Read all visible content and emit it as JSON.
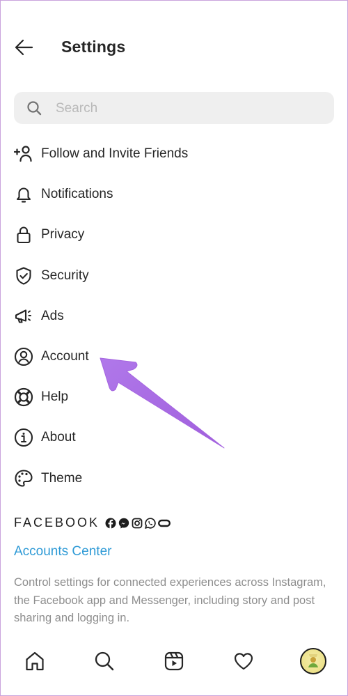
{
  "header": {
    "title": "Settings",
    "back_icon": "arrow-left-icon"
  },
  "search": {
    "placeholder": "Search",
    "value": "",
    "icon": "search-icon"
  },
  "menu": {
    "items": [
      {
        "label": "Follow and Invite Friends",
        "icon": "add-person-icon"
      },
      {
        "label": "Notifications",
        "icon": "bell-icon"
      },
      {
        "label": "Privacy",
        "icon": "lock-icon"
      },
      {
        "label": "Security",
        "icon": "shield-check-icon"
      },
      {
        "label": "Ads",
        "icon": "megaphone-icon"
      },
      {
        "label": "Account",
        "icon": "user-circle-icon"
      },
      {
        "label": "Help",
        "icon": "lifebuoy-icon"
      },
      {
        "label": "About",
        "icon": "info-icon"
      },
      {
        "label": "Theme",
        "icon": "palette-icon"
      }
    ]
  },
  "facebook": {
    "wordmark": "FACEBOOK",
    "app_icons": [
      "facebook-icon",
      "messenger-icon",
      "instagram-icon",
      "whatsapp-icon",
      "oculus-icon"
    ],
    "accounts_center": "Accounts Center",
    "description": "Control settings for connected experiences across Instagram, the Facebook app and Messenger, including story and post sharing and logging in."
  },
  "bottom_nav": {
    "tabs": [
      {
        "name": "home",
        "icon": "home-icon"
      },
      {
        "name": "search",
        "icon": "search-icon"
      },
      {
        "name": "reels",
        "icon": "reels-icon"
      },
      {
        "name": "activity",
        "icon": "heart-icon"
      },
      {
        "name": "profile",
        "icon": "avatar"
      }
    ]
  },
  "annotation": {
    "type": "arrow",
    "points_to": "Account",
    "color": "#a56be0"
  },
  "colors": {
    "link": "#2e9ad6",
    "search_bg": "#efefef",
    "text": "#262626",
    "muted": "#8e8e8e"
  }
}
